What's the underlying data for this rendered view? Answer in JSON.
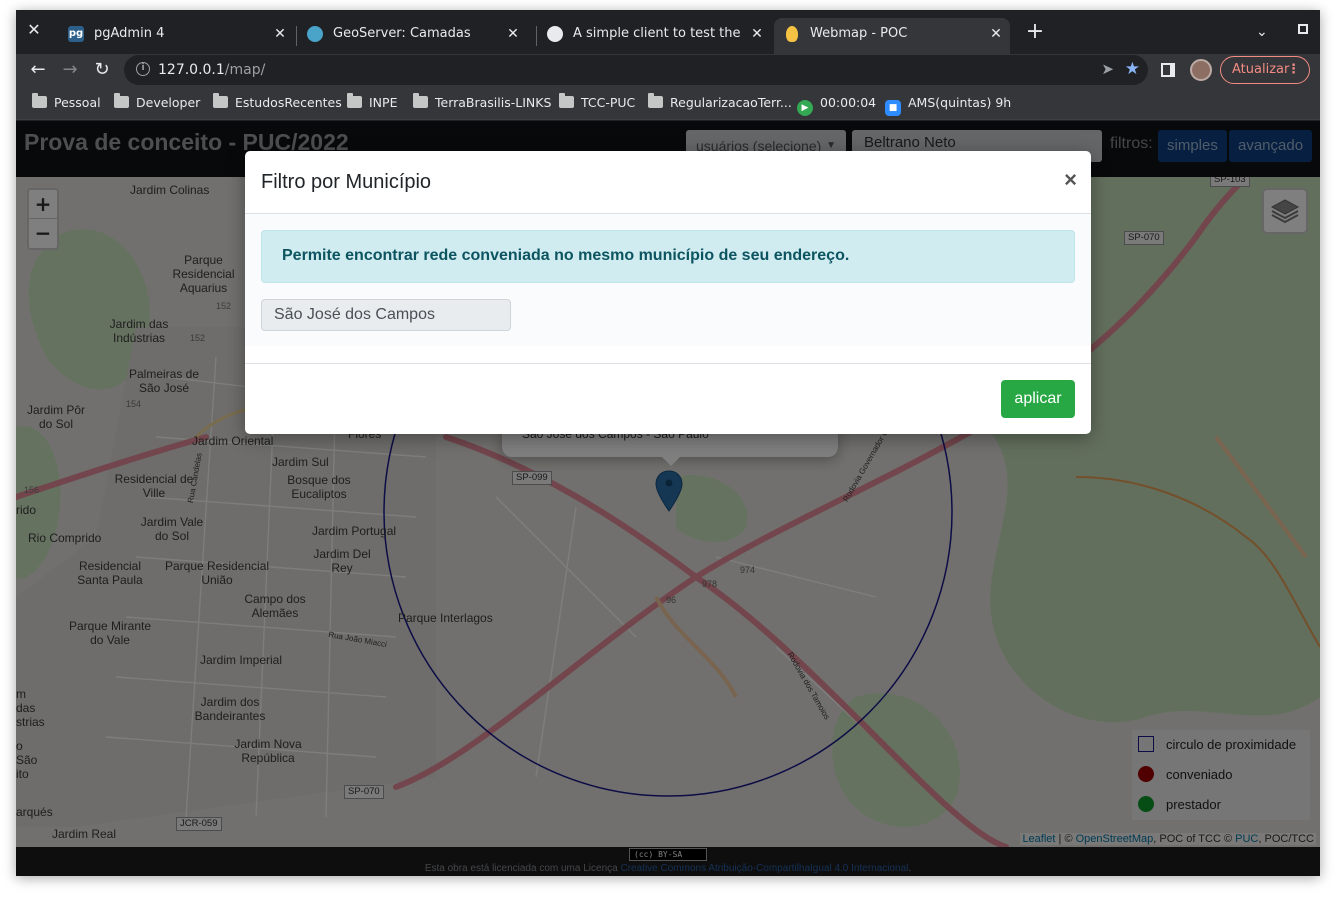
{
  "browser": {
    "tabs": [
      {
        "title": "pgAdmin 4",
        "favicon": "pg"
      },
      {
        "title": "GeoServer: Camadas",
        "favicon": "geoserver-icon"
      },
      {
        "title": "A simple client to test the Addre",
        "favicon": "globe-icon"
      },
      {
        "title": "Webmap - POC",
        "favicon": "lightbulb-icon"
      }
    ],
    "url_host": "127.0.0.1",
    "url_path": "/map/",
    "update_label": "Atualizar",
    "bookmarks": [
      "Pessoal",
      "Developer",
      "EstudosRecentes",
      "INPE",
      "TerraBrasilis-LINKS",
      "TCC-PUC",
      "RegularizacaoTerr...",
      "00:00:04",
      "AMS(quintas) 9h"
    ]
  },
  "navbar": {
    "brand": "Prova de conceito - PUC/2022",
    "user_select": "usuários (selecione)",
    "user_name": "Beltrano Neto",
    "filters_label": "filtros:",
    "btn_simple": "simples",
    "btn_advanced": "avançado"
  },
  "map": {
    "zoom_in": "+",
    "zoom_out": "−",
    "popup_text": "São José dos Campos - São Paulo",
    "legend": [
      {
        "label": "circulo de proximidade",
        "color": "#1a1a8c"
      },
      {
        "label": "conveniado",
        "color": "#a00000"
      },
      {
        "label": "prestador",
        "color": "#0a9a2a"
      }
    ],
    "attribution": {
      "leaflet": "Leaflet",
      "sep1": " | © ",
      "osm": "OpenStreetMap",
      "mid": ", POC of TCC © ",
      "puc": "PUC",
      "tail": ", POC/TCC"
    },
    "places": [
      "Jardim Colinas",
      "Parque Residencial Aquarius",
      "Jardim das Indústrias",
      "Palmeiras de São José",
      "Jardim Pôr do Sol",
      "Jardim Oriental",
      "Residencial de Ville",
      "Jardim Sul",
      "Bosque dos Eucaliptos",
      "Jardim Vale do Sol",
      "Rio Comprido",
      "Jardim Portugal",
      "Jardim Del Rey",
      "Residencial Santa Paula",
      "Parque Residencial União",
      "Campo dos Alemães",
      "Parque Interlagos",
      "Parque Mirante do Vale",
      "Jardim Imperial",
      "Jardim dos Bandeirantes",
      "Jardim Nova República",
      "Jardim Real",
      "Flores",
      "rido",
      "m das strias",
      "o São ito",
      "arqués"
    ],
    "roads": [
      "SP-099",
      "SP-070",
      "SP-070",
      "SP-103",
      "JCR-059",
      "152",
      "152",
      "154",
      "156",
      "978",
      "974",
      "96"
    ],
    "street_names": [
      "Rua Candelas",
      "Rua João Miacci",
      "Rodovia Governador Ca",
      "Rodovia dos Tamoios"
    ]
  },
  "footer": {
    "badge": "(cc) BY-SA",
    "license_text": "Esta obra está licenciada com uma Licença ",
    "license_link": "Creative Commons Atribuição-CompartilhaIgual 4.0 Internacional",
    "license_end": "."
  },
  "modal": {
    "title": "Filtro por Município",
    "close": "×",
    "info": "Permite encontrar rede conveniada no mesmo município de seu endereço.",
    "municipio_value": "São José dos Campos",
    "apply_label": "aplicar"
  }
}
